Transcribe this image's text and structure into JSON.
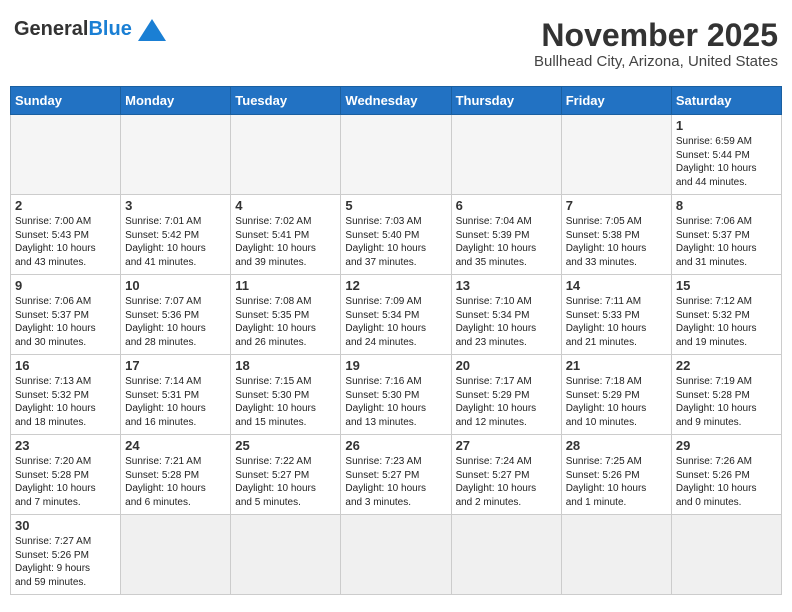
{
  "logo": {
    "general": "General",
    "blue": "Blue"
  },
  "title": "November 2025",
  "subtitle": "Bullhead City, Arizona, United States",
  "weekdays": [
    "Sunday",
    "Monday",
    "Tuesday",
    "Wednesday",
    "Thursday",
    "Friday",
    "Saturday"
  ],
  "weeks": [
    [
      {
        "day": "",
        "info": "",
        "empty": true
      },
      {
        "day": "",
        "info": "",
        "empty": true
      },
      {
        "day": "",
        "info": "",
        "empty": true
      },
      {
        "day": "",
        "info": "",
        "empty": true
      },
      {
        "day": "",
        "info": "",
        "empty": true
      },
      {
        "day": "",
        "info": "",
        "empty": true
      },
      {
        "day": "1",
        "info": "Sunrise: 6:59 AM\nSunset: 5:44 PM\nDaylight: 10 hours\nand 44 minutes."
      }
    ],
    [
      {
        "day": "2",
        "info": "Sunrise: 7:00 AM\nSunset: 5:43 PM\nDaylight: 10 hours\nand 43 minutes."
      },
      {
        "day": "3",
        "info": "Sunrise: 7:01 AM\nSunset: 5:42 PM\nDaylight: 10 hours\nand 41 minutes."
      },
      {
        "day": "4",
        "info": "Sunrise: 7:02 AM\nSunset: 5:41 PM\nDaylight: 10 hours\nand 39 minutes."
      },
      {
        "day": "5",
        "info": "Sunrise: 7:03 AM\nSunset: 5:40 PM\nDaylight: 10 hours\nand 37 minutes."
      },
      {
        "day": "6",
        "info": "Sunrise: 7:04 AM\nSunset: 5:39 PM\nDaylight: 10 hours\nand 35 minutes."
      },
      {
        "day": "7",
        "info": "Sunrise: 7:05 AM\nSunset: 5:38 PM\nDaylight: 10 hours\nand 33 minutes."
      },
      {
        "day": "8",
        "info": "Sunrise: 7:06 AM\nSunset: 5:37 PM\nDaylight: 10 hours\nand 31 minutes."
      }
    ],
    [
      {
        "day": "9",
        "info": "Sunrise: 7:06 AM\nSunset: 5:37 PM\nDaylight: 10 hours\nand 30 minutes."
      },
      {
        "day": "10",
        "info": "Sunrise: 7:07 AM\nSunset: 5:36 PM\nDaylight: 10 hours\nand 28 minutes."
      },
      {
        "day": "11",
        "info": "Sunrise: 7:08 AM\nSunset: 5:35 PM\nDaylight: 10 hours\nand 26 minutes."
      },
      {
        "day": "12",
        "info": "Sunrise: 7:09 AM\nSunset: 5:34 PM\nDaylight: 10 hours\nand 24 minutes."
      },
      {
        "day": "13",
        "info": "Sunrise: 7:10 AM\nSunset: 5:34 PM\nDaylight: 10 hours\nand 23 minutes."
      },
      {
        "day": "14",
        "info": "Sunrise: 7:11 AM\nSunset: 5:33 PM\nDaylight: 10 hours\nand 21 minutes."
      },
      {
        "day": "15",
        "info": "Sunrise: 7:12 AM\nSunset: 5:32 PM\nDaylight: 10 hours\nand 19 minutes."
      }
    ],
    [
      {
        "day": "16",
        "info": "Sunrise: 7:13 AM\nSunset: 5:32 PM\nDaylight: 10 hours\nand 18 minutes."
      },
      {
        "day": "17",
        "info": "Sunrise: 7:14 AM\nSunset: 5:31 PM\nDaylight: 10 hours\nand 16 minutes."
      },
      {
        "day": "18",
        "info": "Sunrise: 7:15 AM\nSunset: 5:30 PM\nDaylight: 10 hours\nand 15 minutes."
      },
      {
        "day": "19",
        "info": "Sunrise: 7:16 AM\nSunset: 5:30 PM\nDaylight: 10 hours\nand 13 minutes."
      },
      {
        "day": "20",
        "info": "Sunrise: 7:17 AM\nSunset: 5:29 PM\nDaylight: 10 hours\nand 12 minutes."
      },
      {
        "day": "21",
        "info": "Sunrise: 7:18 AM\nSunset: 5:29 PM\nDaylight: 10 hours\nand 10 minutes."
      },
      {
        "day": "22",
        "info": "Sunrise: 7:19 AM\nSunset: 5:28 PM\nDaylight: 10 hours\nand 9 minutes."
      }
    ],
    [
      {
        "day": "23",
        "info": "Sunrise: 7:20 AM\nSunset: 5:28 PM\nDaylight: 10 hours\nand 7 minutes."
      },
      {
        "day": "24",
        "info": "Sunrise: 7:21 AM\nSunset: 5:28 PM\nDaylight: 10 hours\nand 6 minutes."
      },
      {
        "day": "25",
        "info": "Sunrise: 7:22 AM\nSunset: 5:27 PM\nDaylight: 10 hours\nand 5 minutes."
      },
      {
        "day": "26",
        "info": "Sunrise: 7:23 AM\nSunset: 5:27 PM\nDaylight: 10 hours\nand 3 minutes."
      },
      {
        "day": "27",
        "info": "Sunrise: 7:24 AM\nSunset: 5:27 PM\nDaylight: 10 hours\nand 2 minutes."
      },
      {
        "day": "28",
        "info": "Sunrise: 7:25 AM\nSunset: 5:26 PM\nDaylight: 10 hours\nand 1 minute."
      },
      {
        "day": "29",
        "info": "Sunrise: 7:26 AM\nSunset: 5:26 PM\nDaylight: 10 hours\nand 0 minutes."
      }
    ],
    [
      {
        "day": "30",
        "info": "Sunrise: 7:27 AM\nSunset: 5:26 PM\nDaylight: 9 hours\nand 59 minutes.",
        "lastrow": true
      },
      {
        "day": "",
        "info": "",
        "empty": true,
        "lastrow": true
      },
      {
        "day": "",
        "info": "",
        "empty": true,
        "lastrow": true
      },
      {
        "day": "",
        "info": "",
        "empty": true,
        "lastrow": true
      },
      {
        "day": "",
        "info": "",
        "empty": true,
        "lastrow": true
      },
      {
        "day": "",
        "info": "",
        "empty": true,
        "lastrow": true
      },
      {
        "day": "",
        "info": "",
        "empty": true,
        "lastrow": true
      }
    ]
  ]
}
